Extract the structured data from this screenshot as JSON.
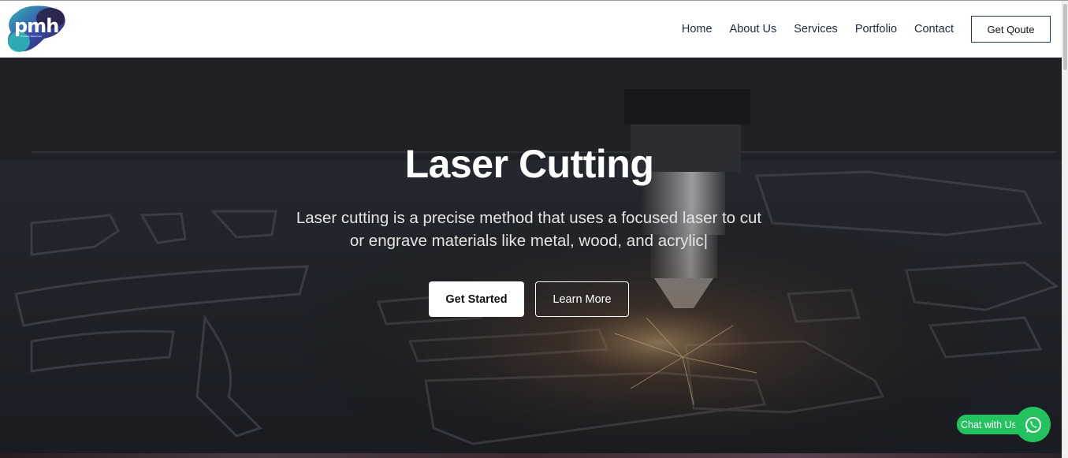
{
  "header": {
    "logo_text": "pmh",
    "logo_tagline": "Precision Metal Hub",
    "nav": [
      {
        "label": "Home"
      },
      {
        "label": "About Us"
      },
      {
        "label": "Services"
      },
      {
        "label": "Portfolio"
      },
      {
        "label": "Contact"
      }
    ],
    "quote_label": "Get Qoute"
  },
  "hero": {
    "title": "Laser Cutting",
    "subtitle": "Laser cutting is a precise method that uses a focused laser to cut or engrave materials like metal, wood, and acrylic|",
    "primary_button": "Get Started",
    "secondary_button": "Learn More"
  },
  "chat": {
    "label": "Chat with Us",
    "icon": "whatsapp-icon"
  },
  "colors": {
    "nav_text": "#1f2a3d",
    "quote_border": "#1d3a54",
    "chat_green": "#22c35e",
    "hero_dark": "#1c1d22"
  }
}
